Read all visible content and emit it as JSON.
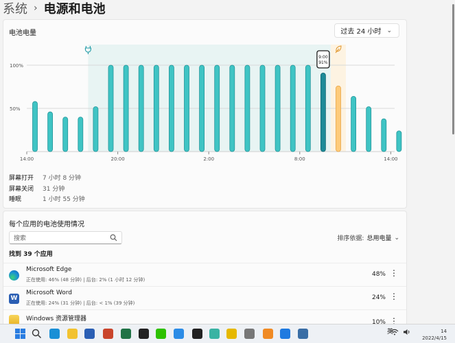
{
  "breadcrumb": {
    "parent": "系统",
    "separator": "›",
    "title": "电源和电池"
  },
  "chart_card": {
    "title": "电池电量",
    "period": {
      "selected": "过去 24 小时"
    }
  },
  "chart_data": {
    "type": "bar",
    "x_tick_labels": [
      "14:00",
      "20:00",
      "2:00",
      "8:00",
      "14:00"
    ],
    "y_tick_labels": [
      "100%",
      "50%"
    ],
    "ylim": [
      0,
      100
    ],
    "values": [
      58,
      46,
      40,
      40,
      52,
      100,
      100,
      100,
      100,
      100,
      100,
      100,
      100,
      100,
      100,
      100,
      100,
      100,
      100,
      91,
      76,
      64,
      52,
      38,
      24
    ],
    "charging_range": [
      4,
      19
    ],
    "selected_index": 19,
    "highlight_index": 20,
    "tooltip": {
      "time": "9:00",
      "value": "91%"
    },
    "colors": {
      "bar": "#3fc4c4",
      "bar_stroke": "#23959a",
      "selected": "#1e8a98",
      "highlight": "#ffcb7a",
      "charging_band": "#e8f4f3",
      "highlight_band": "#fdf3e2"
    }
  },
  "stats": [
    {
      "label": "屏幕打开",
      "value": "7 小时 8 分钟"
    },
    {
      "label": "屏幕关闭",
      "value": "31 分钟"
    },
    {
      "label": "睡眠",
      "value": "1 小时 55 分钟"
    }
  ],
  "apps_card": {
    "title": "每个应用的电池使用情况",
    "search_placeholder": "搜索",
    "sort_label": "排序依据:",
    "sort_value": "总用电量",
    "found": "找到 39 个应用",
    "apps": [
      {
        "name": "Microsoft Edge",
        "detail": "正在使用: 46% (48 分钟) | 后台: 2% (1 小时 12 分钟)",
        "percent": "48%",
        "icon": "edge-icon",
        "color": "#1a8fd6"
      },
      {
        "name": "Microsoft Word",
        "detail": "正在使用: 24% (31 分钟) | 后台: < 1% (39 分钟)",
        "percent": "24%",
        "icon": "word-icon",
        "color": "#2b5fb4"
      },
      {
        "name": "Windows 资源管理器",
        "detail": "",
        "percent": "10%",
        "icon": "folder-icon",
        "color": "#f2c230"
      }
    ]
  },
  "taskbar": {
    "icons": [
      "windows-start-icon",
      "search-icon",
      "edge-icon",
      "file-explorer-icon",
      "word-icon",
      "powerpoint-icon",
      "excel-icon",
      "qq-icon",
      "wechat-icon",
      "baidu-netdisk-icon",
      "terminal-icon",
      "vpn-icon",
      "notes-icon",
      "printer-icon",
      "browser-icon",
      "todo-icon",
      "settings-icon"
    ],
    "lang": "英",
    "clock_time": "14",
    "clock_date": "2022/4/15"
  }
}
